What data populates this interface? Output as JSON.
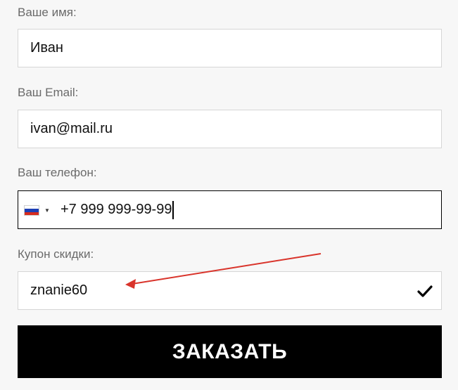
{
  "form": {
    "name": {
      "label": "Ваше имя:",
      "value": "Иван"
    },
    "email": {
      "label": "Ваш Email:",
      "value": "ivan@mail.ru"
    },
    "phone": {
      "label": "Ваш телефон:",
      "value": "+7 999 999-99-99",
      "country_flag": "russia-flag-icon",
      "flag_colors": [
        "#ffffff",
        "#1c3fb5",
        "#d52b1e"
      ]
    },
    "coupon": {
      "label": "Купон скидки:",
      "value": "znanie60",
      "status_icon": "check-icon"
    },
    "submit_label": "ЗАКАЗАТЬ"
  },
  "annotation": {
    "arrow_color": "#d9342b"
  }
}
